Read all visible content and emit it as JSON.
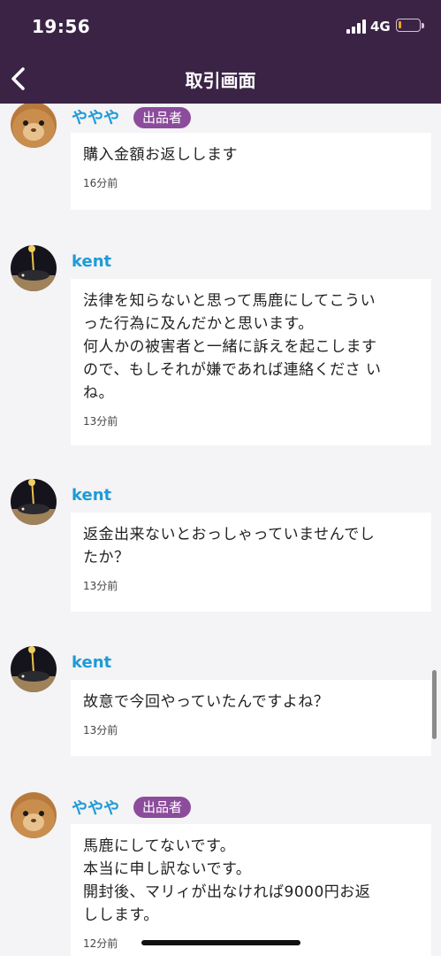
{
  "status_bar": {
    "time": "19:56",
    "network": "4G",
    "battery_color": "#f0a020",
    "battery_level": 0.1
  },
  "nav": {
    "title": "取引画面",
    "back_icon": "chevron-left-icon"
  },
  "seller_badge": "出品者",
  "messages": [
    {
      "sender": "ややや",
      "is_seller": true,
      "avatar": "guinea-pig-avatar",
      "text": "購入金額お返しします",
      "time": "16分前"
    },
    {
      "sender": "kent",
      "is_seller": false,
      "avatar": "night-car-avatar",
      "text": "法律を知らないと思って馬鹿にしてこうい\nった行為に及んだかと思います。\n何人かの被害者と一緒に訴えを起こします\nので、もしそれが嫌であれば連絡くださ い\nね。",
      "time": "13分前"
    },
    {
      "sender": "kent",
      "is_seller": false,
      "avatar": "night-car-avatar",
      "text": "返金出来ないとおっしゃっていませんでし\nたか？",
      "time": "13分前"
    },
    {
      "sender": "kent",
      "is_seller": false,
      "avatar": "night-car-avatar",
      "text": "故意で今回やっていたんですよね？",
      "time": "13分前"
    },
    {
      "sender": "ややや",
      "is_seller": true,
      "avatar": "guinea-pig-avatar",
      "text": "馬鹿にしてないです。\n本当に申し訳ないです。\n開封後、マリィが出なければ9000円お返\nしします。",
      "time": "12分前"
    }
  ],
  "colors": {
    "header": "#3b2346",
    "name": "#1e9bd7",
    "badge": "#8c4c9c",
    "background": "#f4f3f5"
  }
}
